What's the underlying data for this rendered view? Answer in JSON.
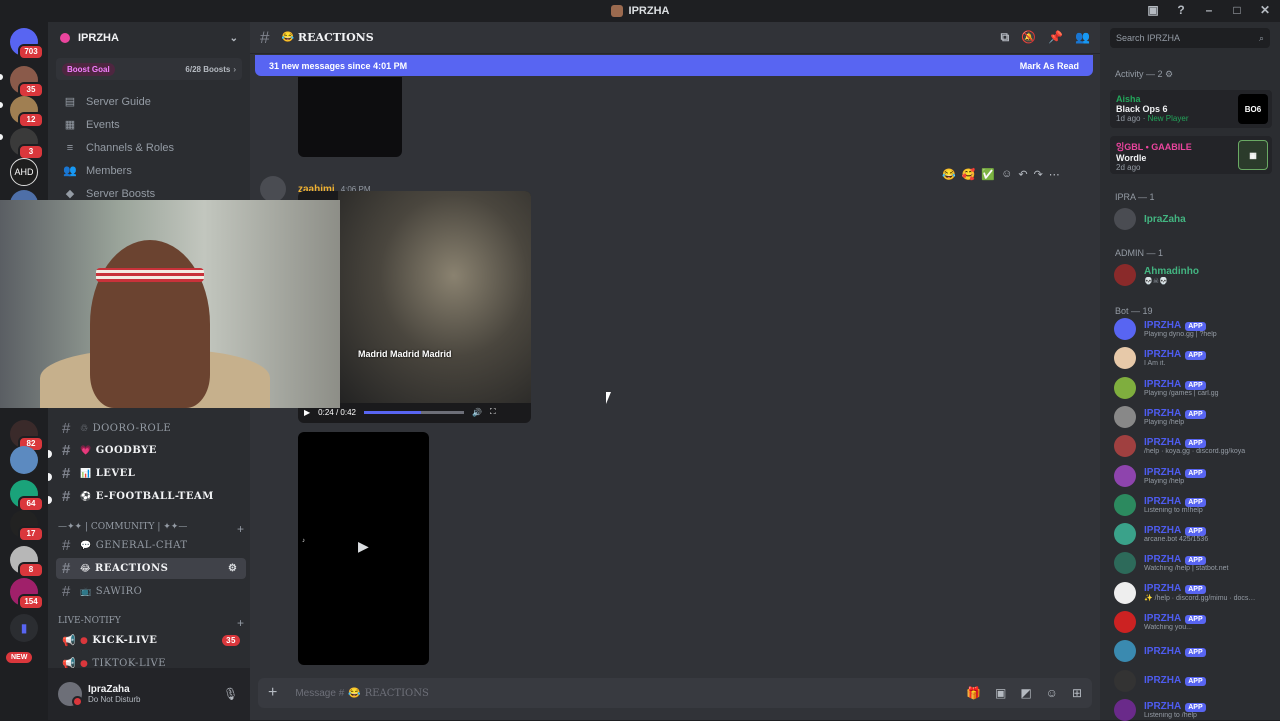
{
  "window": {
    "title": "IPRZHA"
  },
  "rail": {
    "servers": [
      {
        "badge": "703"
      },
      {
        "badge": "35"
      },
      {
        "badge": "12"
      },
      {
        "badge": "3"
      },
      {
        "label": "AHD"
      },
      {
        "badge": "82"
      },
      {
        "badge": ""
      },
      {
        "badge": "64"
      },
      {
        "badge": "17"
      },
      {
        "badge": "8"
      },
      {
        "badge": "154"
      },
      {
        "badge": ""
      },
      {
        "label": "NEW"
      }
    ]
  },
  "sidebar": {
    "server_name": "IPRZHA",
    "boost_goal": "Boost Goal",
    "boost_count": "6/28 Boosts",
    "nav": [
      {
        "label": "Server Guide",
        "icon": "guide-icon"
      },
      {
        "label": "Events",
        "icon": "calendar-icon"
      },
      {
        "label": "Channels & Roles",
        "icon": "channels-icon"
      },
      {
        "label": "Members",
        "icon": "members-icon"
      },
      {
        "label": "Server Boosts",
        "icon": "boost-icon"
      }
    ],
    "channels": [
      {
        "emoji": "♲",
        "label": "DOORO-ROLE"
      },
      {
        "emoji": "💗",
        "label": "GOODBYE"
      },
      {
        "emoji": "📊",
        "label": "LEVEL"
      },
      {
        "emoji": "⚽",
        "label": "E-FOOTBALL-TEAM"
      }
    ],
    "category_community": "—✦✦ | COMMUNITY | ✦✦—",
    "community_channels": [
      {
        "emoji": "💬",
        "label": "GENERAL-CHAT"
      },
      {
        "emoji": "😂",
        "label": "REACTIONS"
      },
      {
        "emoji": "📺",
        "label": "SAWIRO"
      }
    ],
    "category_live": "LIVE-NOTIFY",
    "live_channels": [
      {
        "label": "KICK-LIVE",
        "badge": "35"
      },
      {
        "label": "TIKTOK-LIVE",
        "badge": ""
      }
    ],
    "user": {
      "name": "IpraZaha",
      "status": "Do Not Disturb"
    }
  },
  "main": {
    "channel": "REACTIONS",
    "new_messages": "31 new messages since 4:01 PM",
    "mark_as_read": "Mark As Read",
    "author": "zaahimi",
    "time": "4:06 PM",
    "video_caption": "Madrid Madrid Madrid",
    "video_time": "0:24 / 0:42",
    "video_progress": 0.57,
    "composer_placeholder": "Message #",
    "composer_channel": "REACTIONS"
  },
  "members": {
    "search_placeholder": "Search IPRZHA",
    "activity_header": "Activity — 2",
    "activities": [
      {
        "user": "Aisha",
        "game": "Black Ops 6",
        "time": "1d ago",
        "extra": "New Player",
        "thumb": "BO6"
      },
      {
        "user": "잉GBL • GAABILE",
        "game": "Wordle",
        "time": "2d ago",
        "extra": "",
        "thumb": ""
      }
    ],
    "groups": [
      {
        "header": "IPRA — 1",
        "rows": [
          {
            "name": "IpraZaha",
            "sub": ""
          }
        ]
      },
      {
        "header": "ADMIN — 1",
        "rows": [
          {
            "name": "Ahmadinho",
            "sub": "💀☠💀"
          }
        ]
      }
    ],
    "bot_header": "Bot — 19",
    "app_label": "APP",
    "bots": [
      {
        "name": "IPRZHA",
        "sub": "Playing dyno.gg | ?help"
      },
      {
        "name": "IPRZHA",
        "sub": "I Am it."
      },
      {
        "name": "IPRZHA",
        "sub": "Playing /games | carl.gg"
      },
      {
        "name": "IPRZHA",
        "sub": "Playing /help"
      },
      {
        "name": "IPRZHA",
        "sub": "/help · koya.gg · discord.gg/koya"
      },
      {
        "name": "IPRZHA",
        "sub": "Playing /help"
      },
      {
        "name": "IPRZHA",
        "sub": "Listening to m!help"
      },
      {
        "name": "IPRZHA",
        "sub": "arcane.bot 425/1536"
      },
      {
        "name": "IPRZHA",
        "sub": "Watching /help | statbot.net"
      },
      {
        "name": "IPRZHA",
        "sub": "✨ /help · discord.gg/mimu · docs…"
      },
      {
        "name": "IPRZHA",
        "sub": "Watching you..."
      },
      {
        "name": "IPRZHA",
        "sub": ""
      },
      {
        "name": "IPRZHA",
        "sub": ""
      },
      {
        "name": "IPRZHA",
        "sub": "Listening to /help"
      }
    ]
  }
}
